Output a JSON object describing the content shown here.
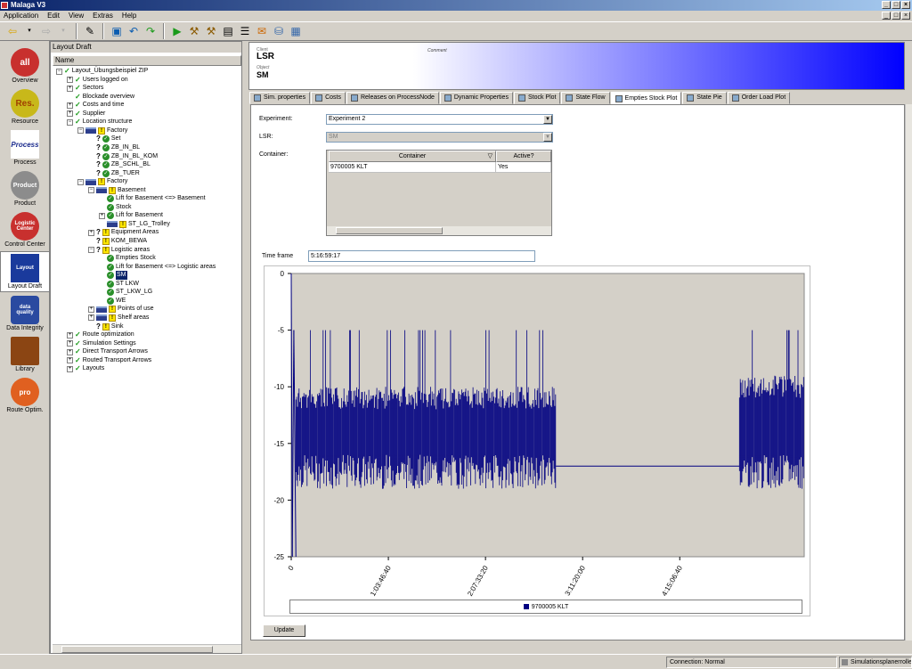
{
  "window": {
    "title": "Malaga V3"
  },
  "menu": [
    "Application",
    "Edit",
    "View",
    "Extras",
    "Help"
  ],
  "sidebar": [
    {
      "label": "Overview",
      "icon": "overview-icon",
      "badge": "all"
    },
    {
      "label": "Resource",
      "icon": "resource-icon",
      "badge": "Res."
    },
    {
      "label": "Process",
      "icon": "process-icon",
      "badge": "Process"
    },
    {
      "label": "Product",
      "icon": "product-icon",
      "badge": "Product"
    },
    {
      "label": "Control Center",
      "icon": "control-center-icon",
      "badge": "Logistic Center"
    },
    {
      "label": "Layout Draft",
      "icon": "layout-draft-icon",
      "badge": "Layout"
    },
    {
      "label": "Data Integrity",
      "icon": "data-integrity-icon",
      "badge": "data quality"
    },
    {
      "label": "Library",
      "icon": "library-icon",
      "badge": ""
    },
    {
      "label": "Route Optim.",
      "icon": "route-optim-icon",
      "badge": "pro"
    }
  ],
  "tree": {
    "panel_title": "Layout Draft",
    "column_header": "Name",
    "nodes": [
      {
        "label": "Layout_Übungsbeispiel ZIP",
        "icon": "check"
      },
      {
        "label": "Users logged on",
        "icon": "check"
      },
      {
        "label": "Sectors",
        "icon": "check"
      },
      {
        "label": "Blockade overview",
        "icon": "check"
      },
      {
        "label": "Costs and time",
        "icon": "check"
      },
      {
        "label": "Supplier",
        "icon": "check"
      },
      {
        "label": "Location structure",
        "icon": "check"
      },
      {
        "label": "Factory",
        "icon": "warn"
      },
      {
        "label": "Set",
        "icon": "gchk"
      },
      {
        "label": "ZB_IN_BL",
        "icon": "gchk"
      },
      {
        "label": "ZB_IN_BL_KOM",
        "icon": "gchk"
      },
      {
        "label": "ZB_SCHL_BL",
        "icon": "gchk"
      },
      {
        "label": "ZB_TUER",
        "icon": "gchk"
      },
      {
        "label": "Factory",
        "icon": "warn"
      },
      {
        "label": "Basement",
        "icon": "warn"
      },
      {
        "label": "Lift for Basement <=> Basement",
        "icon": "gchk"
      },
      {
        "label": "Stock",
        "icon": "gchk"
      },
      {
        "label": "Lift for Basement",
        "icon": "gchk"
      },
      {
        "label": "ST_LG_Trolley",
        "icon": "warn"
      },
      {
        "label": "Equipment Areas",
        "icon": "warn"
      },
      {
        "label": "KOM_BEWA",
        "icon": "warn"
      },
      {
        "label": "Logistic areas",
        "icon": "warn"
      },
      {
        "label": "Empties Stock",
        "icon": "gchk"
      },
      {
        "label": "Lift for Basement <=> Logistic areas",
        "icon": "gchk"
      },
      {
        "label": "SM",
        "icon": "gchk"
      },
      {
        "label": "ST LKW",
        "icon": "gchk"
      },
      {
        "label": "ST_LKW_LG",
        "icon": "gchk"
      },
      {
        "label": "WE",
        "icon": "gchk"
      },
      {
        "label": "Points of use",
        "icon": "warn"
      },
      {
        "label": "Shelf areas",
        "icon": "warn"
      },
      {
        "label": "Sink",
        "icon": "warn"
      },
      {
        "label": "Route optimization",
        "icon": "check"
      },
      {
        "label": "Simulation Settings",
        "icon": "check"
      },
      {
        "label": "Direct Transport Arrows",
        "icon": "check"
      },
      {
        "label": "Routed Transport Arrows",
        "icon": "check"
      },
      {
        "label": "Layouts",
        "icon": "check"
      }
    ]
  },
  "banner": {
    "client_label": "Client",
    "client_value": "LSR",
    "object_label": "Object",
    "object_value": "SM",
    "comment_label": "Comment"
  },
  "tabs": [
    {
      "label": "Sim. properties",
      "active": false
    },
    {
      "label": "Costs",
      "active": false
    },
    {
      "label": "Releases on ProcessNode",
      "active": false
    },
    {
      "label": "Dynamic Properties",
      "active": false
    },
    {
      "label": "Stock Plot",
      "active": false
    },
    {
      "label": "State Flow",
      "active": false
    },
    {
      "label": "Empties Stock Plot",
      "active": true
    },
    {
      "label": "State Pie",
      "active": false
    },
    {
      "label": "Order Load Plot",
      "active": false
    }
  ],
  "form": {
    "experiment_label": "Experiment:",
    "experiment_value": "Experiment 2",
    "lsr_label": "LSR:",
    "lsr_value": "SM",
    "container_label": "Container:",
    "grid_headers": [
      "Container",
      "Active?"
    ],
    "grid_rows": [
      [
        "9700005 KLT",
        "Yes"
      ]
    ],
    "timeframe_label": "Time frame",
    "timeframe_value": "5:16:59:17",
    "update_button": "Update"
  },
  "chart_data": {
    "type": "line",
    "title": "",
    "xlabel": "",
    "ylabel": "",
    "ylim": [
      -25,
      0
    ],
    "yticks": [
      0,
      -5,
      -10,
      -15,
      -20,
      -25
    ],
    "xticks": [
      "0",
      "1:03:46:40",
      "2:07:33:20",
      "3:11:20:00",
      "4:15:06:40"
    ],
    "xlim_seconds": [
      0,
      494357
    ],
    "legend": "bottom",
    "grid": false,
    "background": "#d4d0c8",
    "series": [
      {
        "name": "9700005 KLT",
        "color": "#000080",
        "description_x": "time",
        "segments": [
          {
            "x": [
              0,
              1000
            ],
            "y": [
              0,
              -25
            ]
          },
          {
            "x": [
              1000,
              2500
            ],
            "y": [
              -25,
              -5
            ]
          },
          {
            "x": [
              2500,
              4500
            ],
            "y": [
              -5,
              -25
            ]
          },
          {
            "x": [
              4500,
              255000
            ],
            "y_range": [
              -19,
              -10
            ],
            "spikes_to": -5
          },
          {
            "x": [
              255000,
              432000
            ],
            "y": [
              -17,
              -17
            ]
          },
          {
            "x": [
              432000,
              494357
            ],
            "y_range": [
              -19,
              -9
            ],
            "spikes_to": -5
          }
        ]
      }
    ]
  },
  "status": {
    "connection": "Connection: Normal",
    "user": "Simulationsplanerrolle"
  },
  "colors": {
    "accent": "#0a246a",
    "banner": "#0000ff",
    "series": "#000080"
  }
}
